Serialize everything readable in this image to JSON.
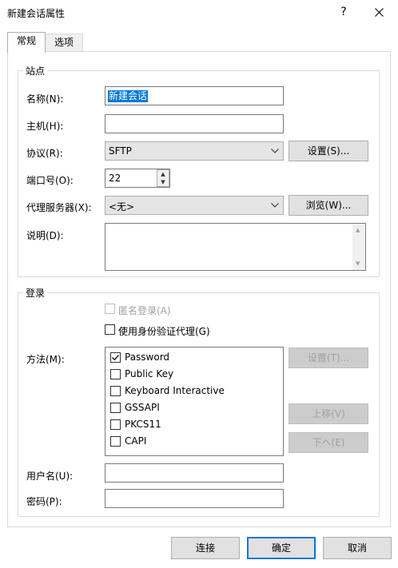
{
  "window": {
    "title": "新建会话属性",
    "help_glyph": "?"
  },
  "tabs": [
    {
      "label": "常规",
      "active": true
    },
    {
      "label": "选项",
      "active": false
    }
  ],
  "site_group": {
    "title": "站点",
    "name_label": "名称(N):",
    "name_value": "新建会话",
    "host_label": "主机(H):",
    "host_value": "",
    "protocol_label": "协议(R):",
    "protocol_value": "SFTP",
    "protocol_settings_btn": "设置(S)...",
    "port_label": "端口号(O):",
    "port_value": "22",
    "proxy_label": "代理服务器(X):",
    "proxy_value": "<无>",
    "proxy_browse_btn": "浏览(W)...",
    "desc_label": "说明(D):",
    "desc_value": ""
  },
  "login_group": {
    "title": "登录",
    "anonymous_label": "匿名登录(A)",
    "anonymous_checked": false,
    "agent_label": "使用身份验证代理(G)",
    "agent_checked": false,
    "method_label": "方法(M):",
    "methods": [
      {
        "label": "Password",
        "checked": true
      },
      {
        "label": "Public Key",
        "checked": false
      },
      {
        "label": "Keyboard Interactive",
        "checked": false
      },
      {
        "label": "GSSAPI",
        "checked": false
      },
      {
        "label": "PKCS11",
        "checked": false
      },
      {
        "label": "CAPI",
        "checked": false
      }
    ],
    "method_settings_btn": "设置(T)...",
    "move_up_btn": "上移(V)",
    "move_down_btn": "下へ(E)",
    "username_label": "用户名(U):",
    "username_value": "",
    "password_label": "密码(P):",
    "password_value": ""
  },
  "footer": {
    "connect_btn": "连接",
    "ok_btn": "确定",
    "cancel_btn": "取消"
  },
  "colors": {
    "accent": "#0078d7",
    "selection": "#0078d7",
    "disabled_text": "#a0a0a0"
  }
}
